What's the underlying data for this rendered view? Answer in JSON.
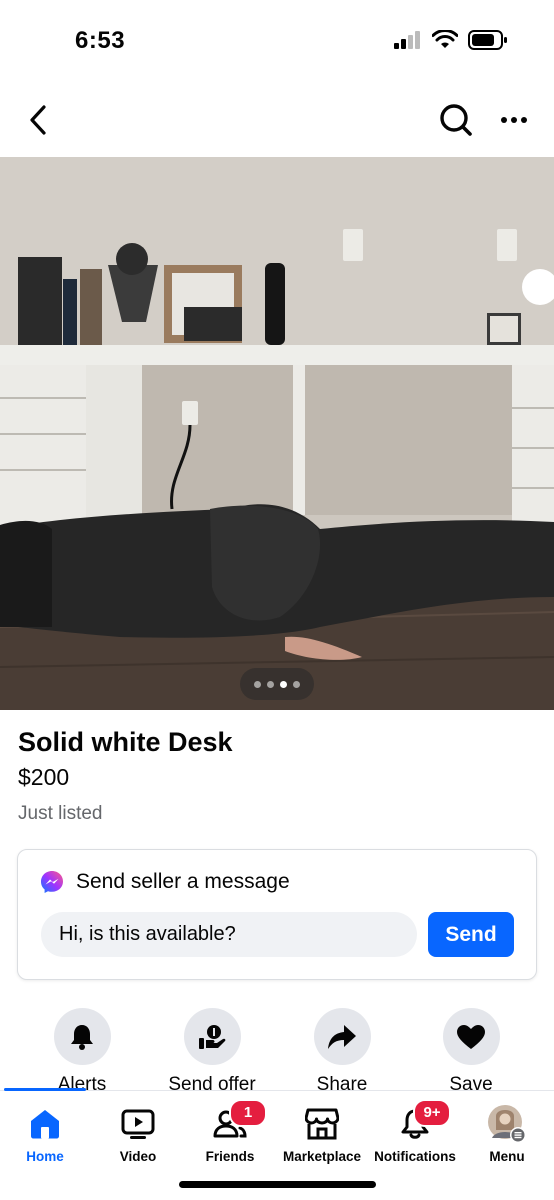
{
  "status_bar": {
    "time": "6:53"
  },
  "listing": {
    "title": "Solid white Desk",
    "price": "$200",
    "status": "Just listed",
    "photo_count": 4,
    "photo_index": 3
  },
  "message": {
    "header": "Send seller a message",
    "input_value": "Hi, is this available?",
    "send_label": "Send"
  },
  "actions": [
    {
      "label": "Alerts",
      "icon": "bell-icon"
    },
    {
      "label": "Send offer",
      "icon": "offer-icon"
    },
    {
      "label": "Share",
      "icon": "share-icon"
    },
    {
      "label": "Save",
      "icon": "heart-icon"
    }
  ],
  "tabs": [
    {
      "label": "Home",
      "icon": "home-icon",
      "active": true
    },
    {
      "label": "Video",
      "icon": "video-icon"
    },
    {
      "label": "Friends",
      "icon": "friends-icon",
      "badge": "1"
    },
    {
      "label": "Marketplace",
      "icon": "marketplace-icon"
    },
    {
      "label": "Notifications",
      "icon": "bell-icon",
      "badge": "9+"
    },
    {
      "label": "Menu",
      "icon": "avatar"
    }
  ],
  "colors": {
    "accent": "#0866ff",
    "badge": "#e41e3f",
    "muted_text": "#65676b",
    "chip_bg": "#e4e6eb"
  }
}
